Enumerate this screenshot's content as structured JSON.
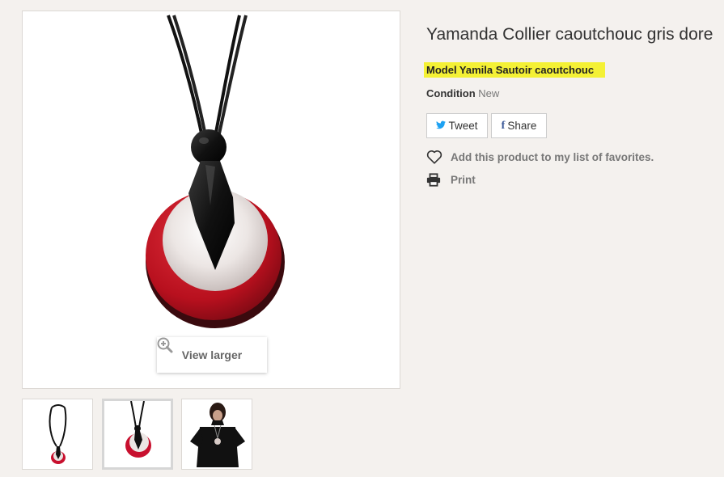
{
  "product": {
    "title": "Yamanda Collier caoutchouc gris dore",
    "model": "Model Yamila Sautoir caoutchouc",
    "condition_label": "Condition",
    "condition_value": "New"
  },
  "gallery": {
    "view_larger_label": "View larger",
    "thumbnails": [
      "necklace-full",
      "pendant-closeup",
      "model-wearing"
    ],
    "selected_index": 1
  },
  "social": {
    "tweet_label": "Tweet",
    "share_label": "Share"
  },
  "actions": {
    "favorites_label": "Add this product to my list of favorites.",
    "print_label": "Print"
  },
  "colors": {
    "highlight": "#f4f135",
    "pendant_red": "#c8102e",
    "twitter": "#1da1f2",
    "facebook": "#3b5998"
  }
}
